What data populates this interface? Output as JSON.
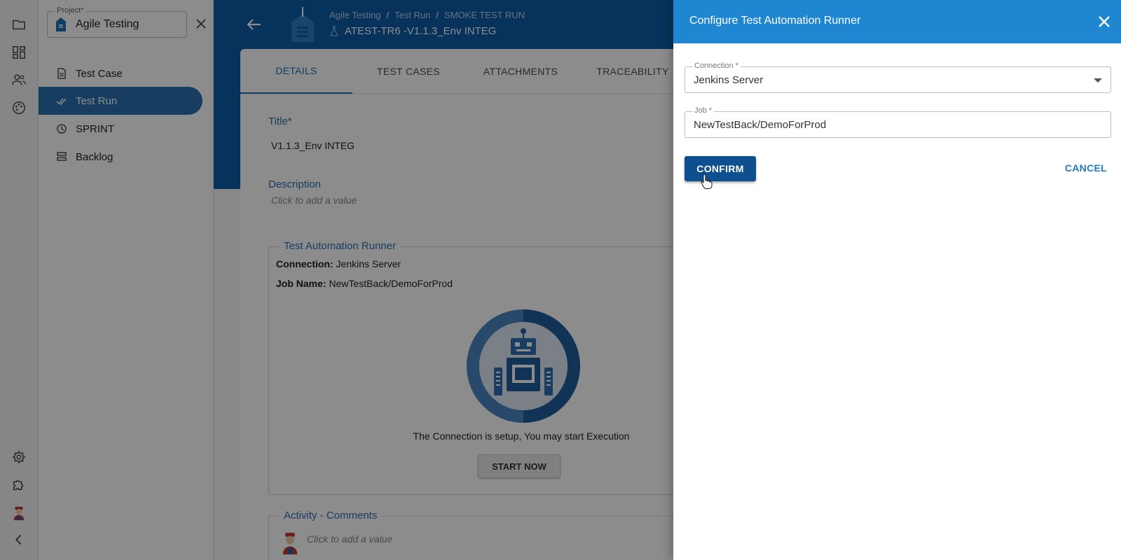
{
  "sidebar_rail": {
    "icons": [
      "folder-icon",
      "dashboard-icon",
      "users-icon",
      "palette-icon"
    ],
    "bottom_icons": [
      "settings-icon",
      "puzzle-icon",
      "user-avatar",
      "collapse-chevron-icon"
    ]
  },
  "project": {
    "label": "Project*",
    "value": "Agile Testing"
  },
  "nav": {
    "items": [
      {
        "label": "Test Case",
        "icon": "document-icon"
      },
      {
        "label": "Test Run",
        "icon": "double-check-icon"
      },
      {
        "label": "SPRINT",
        "icon": "history-icon"
      },
      {
        "label": "Backlog",
        "icon": "list-icon"
      }
    ]
  },
  "header": {
    "breadcrumb": [
      "Agile Testing",
      "Test Run",
      "SMOKE TEST RUN"
    ],
    "title": "ATEST-TR6 -V1.1.3_Env INTEG"
  },
  "tabs": [
    "DETAILS",
    "TEST CASES",
    "ATTACHMENTS",
    "TRACEABILITY"
  ],
  "details": {
    "title_label": "Title*",
    "title_value": "V1.1.3_Env INTEG",
    "description_label": "Description",
    "description_placeholder": "Click to add a value",
    "runner": {
      "legend": "Test Automation Runner",
      "connection_key": "Connection:",
      "connection_value": "Jenkins Server",
      "job_key": "Job Name:",
      "job_value": "NewTestBack/DemoForProd",
      "status_text": "The Connection is setup, You may start Execution",
      "start_label": "START NOW"
    },
    "comments": {
      "legend": "Activity - Comments",
      "placeholder": "Click to add a value"
    }
  },
  "drawer": {
    "title": "Configure Test Automation Runner",
    "connection_label": "Connection *",
    "connection_value": "Jenkins Server",
    "job_label": "Job *",
    "job_value": "NewTestBack/DemoForProd",
    "confirm_label": "CONFIRM",
    "cancel_label": "CANCEL"
  },
  "colors": {
    "drawer_header": "#1f87d2",
    "header_band": "#0b5ba7",
    "confirm_button": "#0d4f8f",
    "active_nav": "#2a6fb0"
  }
}
